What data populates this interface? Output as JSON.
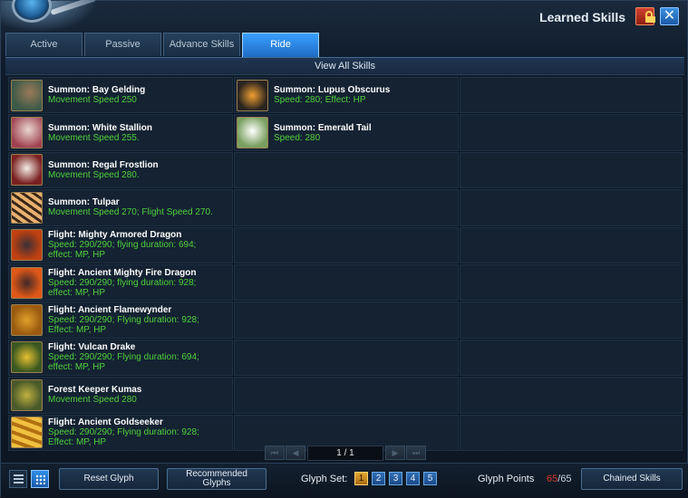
{
  "window": {
    "title": "Learned Skills"
  },
  "tabs": [
    {
      "label": "Active",
      "active": false
    },
    {
      "label": "Passive",
      "active": false
    },
    {
      "label": "Advance Skills",
      "active": false
    },
    {
      "label": "Ride",
      "active": true
    }
  ],
  "view_all_label": "View All Skills",
  "skills": [
    {
      "name": "Summon: Bay Gelding",
      "desc": [
        "Movement Speed 250"
      ],
      "icon": "horse-brown-icon"
    },
    {
      "name": "Summon: Lupus Obscurus",
      "desc": [
        "Speed: 280; Effect: HP"
      ],
      "icon": "wolf-black-icon"
    },
    {
      "name": "Summon: White Stallion",
      "desc": [
        "Movement Speed 255."
      ],
      "icon": "horse-white-icon"
    },
    {
      "name": "Summon: Emerald Tail",
      "desc": [
        "Speed: 280"
      ],
      "icon": "wolf-white-icon"
    },
    {
      "name": "Summon: Regal Frostlion",
      "desc": [
        "Movement Speed 280."
      ],
      "icon": "lion-icon"
    },
    {
      "name": "Summon: Tulpar",
      "desc": [
        "Movement Speed 270; Flight Speed 270."
      ],
      "icon": "zebra-icon"
    },
    {
      "name": "Flight: Mighty Armored Dragon",
      "desc": [
        "Speed: 290/290; flying duration: 694;",
        "effect: MP, HP"
      ],
      "icon": "dragon-red-icon"
    },
    {
      "name": "Flight: Ancient Mighty Fire Dragon",
      "desc": [
        "Speed: 290/290; flying duration: 928;",
        "effect: MP, HP"
      ],
      "icon": "dragon-fire-icon"
    },
    {
      "name": "Flight: Ancient Flamewynder",
      "desc": [
        "Speed: 290/290; Flying duration: 928;",
        "Effect: MP, HP"
      ],
      "icon": "dragon-gold-icon"
    },
    {
      "name": "Flight: Vulcan Drake",
      "desc": [
        "Speed: 290/290; Flying duration: 694;",
        "effect: MP, HP"
      ],
      "icon": "dragon-green-icon"
    },
    {
      "name": "Forest Keeper Kumas",
      "desc": [
        "Movement Speed 280"
      ],
      "icon": "kumas-icon"
    },
    {
      "name": "Flight: Ancient Goldseeker",
      "desc": [
        "Speed: 290/290; Flying duration: 928;",
        "Effect: MP, HP"
      ],
      "icon": "goldseeker-icon"
    }
  ],
  "pagination": {
    "display": "1 / 1"
  },
  "bottom": {
    "reset_glyph": "Reset Glyph",
    "recommended_glyphs": [
      "Recommended",
      "Glyphs"
    ],
    "glyph_set_label": "Glyph Set:",
    "glyph_sets": [
      "1",
      "2",
      "3",
      "4",
      "5"
    ],
    "glyph_set_selected": "1",
    "glyph_points_label": "Glyph Points",
    "glyph_points_current": "65",
    "glyph_points_sep": "/",
    "glyph_points_max": "65",
    "chained_skills": "Chained Skills"
  }
}
